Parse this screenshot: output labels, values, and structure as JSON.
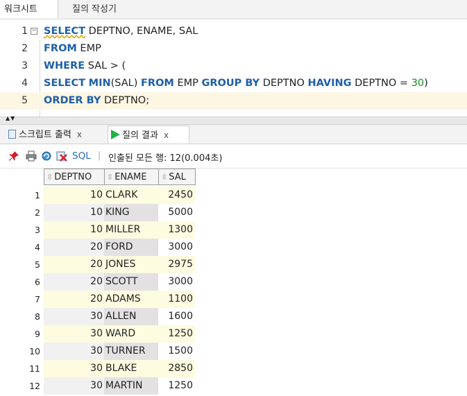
{
  "top_tabs": {
    "worksheet": "워크시트",
    "query_builder": "질의 작성기"
  },
  "editor": {
    "lines": [
      {
        "no": "1",
        "tokens": [
          {
            "t": "SELECT",
            "k": "kw squiggle"
          },
          {
            "t": " DEPTNO, ENAME, SAL",
            "k": "plain"
          }
        ]
      },
      {
        "no": "2",
        "tokens": [
          {
            "t": "FROM",
            "k": "kw"
          },
          {
            "t": " EMP",
            "k": "plain"
          }
        ]
      },
      {
        "no": "3",
        "tokens": [
          {
            "t": "WHERE",
            "k": "kw"
          },
          {
            "t": " SAL > (",
            "k": "plain"
          }
        ]
      },
      {
        "no": "4",
        "tokens": [
          {
            "t": "SELECT",
            "k": "kw"
          },
          {
            "t": " ",
            "k": "plain"
          },
          {
            "t": "MIN",
            "k": "kw"
          },
          {
            "t": "(SAL) ",
            "k": "plain"
          },
          {
            "t": "FROM",
            "k": "kw"
          },
          {
            "t": " EMP ",
            "k": "plain"
          },
          {
            "t": "GROUP BY",
            "k": "kw"
          },
          {
            "t": " DEPTNO ",
            "k": "plain"
          },
          {
            "t": "HAVING",
            "k": "kw"
          },
          {
            "t": " DEPTNO = ",
            "k": "plain"
          },
          {
            "t": "30",
            "k": "num"
          },
          {
            "t": ")",
            "k": "plain"
          }
        ]
      },
      {
        "no": "5",
        "tokens": [
          {
            "t": "ORDER BY",
            "k": "kw"
          },
          {
            "t": " DEPTNO;",
            "k": "plain"
          }
        ]
      }
    ]
  },
  "bottom_tabs": {
    "script_output": "스크립트 출력",
    "query_result": "질의 결과",
    "close": "x"
  },
  "toolbar": {
    "sql_label": "SQL",
    "separator": "|",
    "status": "인출된 모든 행: 12(0.004초)"
  },
  "grid": {
    "columns": [
      "DEPTNO",
      "ENAME",
      "SAL"
    ],
    "rows": [
      {
        "n": "1",
        "deptno": "10",
        "ename": "CLARK",
        "sal": "2450"
      },
      {
        "n": "2",
        "deptno": "10",
        "ename": "KING",
        "sal": "5000"
      },
      {
        "n": "3",
        "deptno": "10",
        "ename": "MILLER",
        "sal": "1300"
      },
      {
        "n": "4",
        "deptno": "20",
        "ename": "FORD",
        "sal": "3000"
      },
      {
        "n": "5",
        "deptno": "20",
        "ename": "JONES",
        "sal": "2975"
      },
      {
        "n": "6",
        "deptno": "20",
        "ename": "SCOTT",
        "sal": "3000"
      },
      {
        "n": "7",
        "deptno": "20",
        "ename": "ADAMS",
        "sal": "1100"
      },
      {
        "n": "8",
        "deptno": "30",
        "ename": "ALLEN",
        "sal": "1600"
      },
      {
        "n": "9",
        "deptno": "30",
        "ename": "WARD",
        "sal": "1250"
      },
      {
        "n": "10",
        "deptno": "30",
        "ename": "TURNER",
        "sal": "1500"
      },
      {
        "n": "11",
        "deptno": "30",
        "ename": "BLAKE",
        "sal": "2850"
      },
      {
        "n": "12",
        "deptno": "30",
        "ename": "MARTIN",
        "sal": "1250"
      }
    ]
  }
}
